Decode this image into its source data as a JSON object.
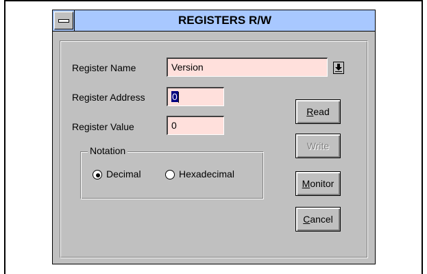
{
  "window": {
    "title": "REGISTERS R/W"
  },
  "form": {
    "name_label": "Register Name",
    "name_value": "Version",
    "address_label": "Register Address",
    "address_value": "0",
    "value_label": "Register Value",
    "value_value": "0"
  },
  "notation": {
    "legend": "Notation",
    "options": [
      {
        "label": "Decimal",
        "selected": true
      },
      {
        "label": "Hexadecimal",
        "selected": false
      }
    ]
  },
  "buttons": {
    "read": {
      "prefix": "",
      "mnemonic": "R",
      "rest": "ead"
    },
    "write": {
      "label": "Write",
      "enabled": false
    },
    "monitor": {
      "prefix": "",
      "mnemonic": "M",
      "rest": "onitor"
    },
    "cancel": {
      "prefix": "",
      "mnemonic": "C",
      "rest": "ancel"
    }
  },
  "colors": {
    "titlebar": "#a8c8ff",
    "field_bg": "#ffe0dc",
    "dialog_bg": "#c0c0c0"
  },
  "icons": {
    "system_menu": "system-menu-icon",
    "dropdown": "dropdown-arrow-icon"
  }
}
